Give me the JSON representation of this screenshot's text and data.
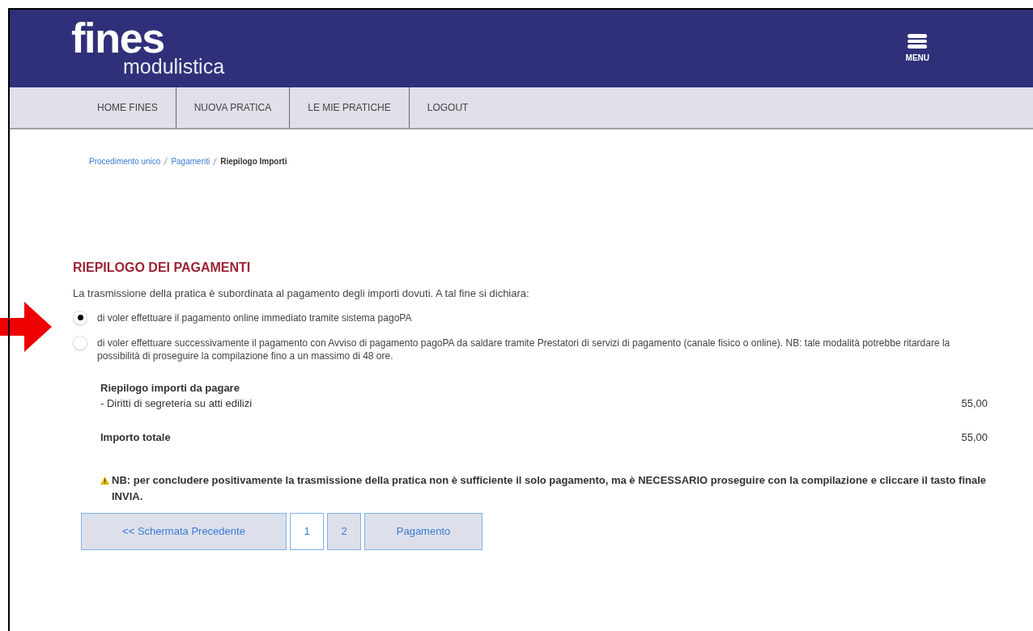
{
  "header": {
    "logo_main": "fines",
    "logo_sub": "modulistica",
    "menu_label": "MENU"
  },
  "nav": [
    "HOME FINES",
    "NUOVA PRATICA",
    "LE MIE PRATICHE",
    "LOGOUT"
  ],
  "breadcrumb": [
    {
      "label": "Procedimento unico",
      "kind": "link"
    },
    {
      "label": "Pagamenti",
      "kind": "link"
    },
    {
      "label": "Riepilogo Importi",
      "kind": "current"
    }
  ],
  "section_title": "RIEPILOGO DEI PAGAMENTI",
  "intro": "La trasmissione della pratica è subordinata al pagamento degli importi dovuti. A tal fine si dichiara:",
  "options": [
    {
      "label": "di voler effettuare il pagamento online immediato tramite sistema pagoPA",
      "selected": true
    },
    {
      "label": "di voler effettuare successivamente il pagamento con Avviso di pagamento pagoPA da saldare tramite Prestatori di servizi di pagamento (canale fisico o online). NB: tale modalità potrebbe ritardare la possibilità di proseguire la compilazione fino a un massimo di 48 ore.",
      "selected": false
    }
  ],
  "summary": {
    "title": "Riepilogo importi da pagare",
    "items": [
      {
        "label": "- Diritti di segreteria su atti edilizi",
        "amount": "55,00"
      }
    ],
    "total_label": "Importo totale",
    "total": "55,00"
  },
  "note": "**NB: per concludere positivamente la trasmissione della pratica non è sufficiente il solo pagamento, ma è NECESSARIO proseguire con la compilazione e cliccare il tasto finale INVIA.**",
  "pager": {
    "back": "<< Schermata Precedente",
    "pages": [
      {
        "label": "1",
        "selected": true
      },
      {
        "label": "2",
        "selected": false
      }
    ],
    "next": "Pagamento"
  }
}
